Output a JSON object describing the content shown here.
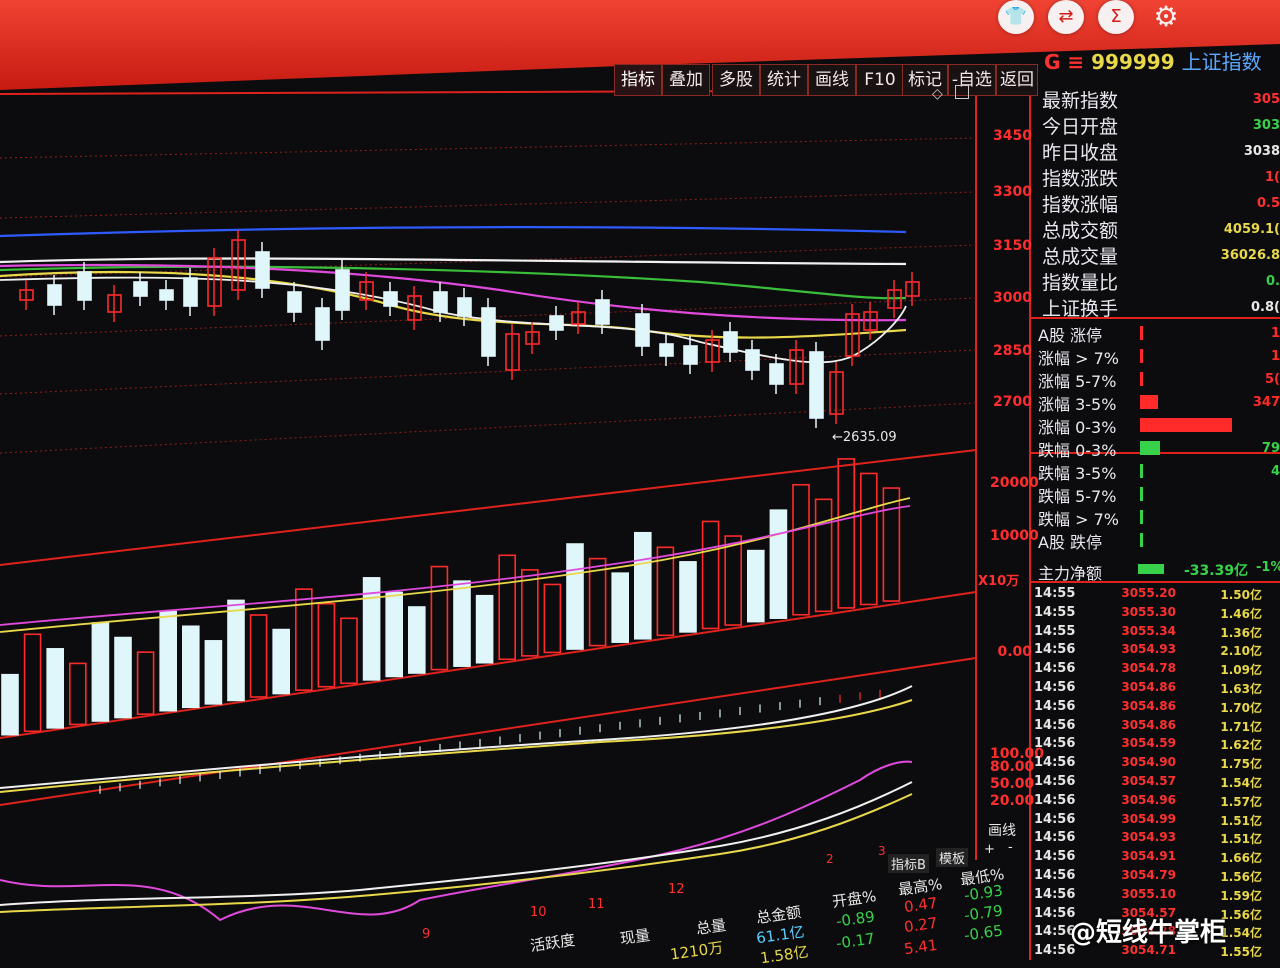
{
  "header": {
    "icons": [
      "shirt-icon",
      "transfer-icon",
      "sigma-icon",
      "gear-icon"
    ]
  },
  "toolbar": {
    "buttons": [
      "指标",
      "叠加",
      "多股",
      "统计",
      "画线",
      "F10",
      "标记",
      "-自选",
      "返回"
    ]
  },
  "stock": {
    "prefix": "G ≡",
    "code": "999999",
    "name": "上证指数"
  },
  "chart": {
    "price_labels": [
      "3450",
      "3300",
      "3150",
      "3000",
      "2850",
      "2700"
    ],
    "low_annotation": "←2635.09",
    "volume_labels": [
      "20000",
      "10000",
      "X10万"
    ],
    "indicator_zero": "0.00",
    "kdj_labels": [
      "100.00",
      "80.00",
      "50.00",
      "20.00"
    ],
    "huaxian": "画线",
    "tabs": [
      "指标B",
      "模板",
      "+",
      "-"
    ],
    "month_labels": [
      "2",
      "3",
      "12",
      "10",
      "11",
      "9"
    ]
  },
  "quote_panel": {
    "rows": [
      {
        "label": "最新指数",
        "value": "305",
        "color": "#ff3030"
      },
      {
        "label": "今日开盘",
        "value": "303",
        "color": "#38d24a"
      },
      {
        "label": "昨日收盘",
        "value": "3038",
        "color": "#e8e8e8"
      },
      {
        "label": "指数涨跌",
        "value": "1(",
        "color": "#ff3030"
      },
      {
        "label": "指数涨幅",
        "value": "0.5",
        "color": "#ff3030"
      },
      {
        "label": "总成交额",
        "value": "4059.1(",
        "color": "#e8d84a"
      },
      {
        "label": "总成交量",
        "value": "36026.8",
        "color": "#e8d84a"
      },
      {
        "label": "指数量比",
        "value": "0.",
        "color": "#38d24a"
      },
      {
        "label": "上证换手",
        "value": "0.8(",
        "color": "#e8e8e8"
      }
    ]
  },
  "breadth": {
    "rows": [
      {
        "label": "A股 涨停",
        "value": "1",
        "bar": 0.02,
        "color": "#ff2a2a"
      },
      {
        "label": "涨幅 > 7%",
        "value": "1",
        "bar": 0.02,
        "color": "#ff2a2a"
      },
      {
        "label": "涨幅 5-7%",
        "value": "5(",
        "bar": 0.03,
        "color": "#ff2a2a"
      },
      {
        "label": "涨幅 3-5%",
        "value": "347",
        "bar": 0.2,
        "color": "#ff2a2a"
      },
      {
        "label": "涨幅 0-3%",
        "value": "",
        "bar": 1.0,
        "color": "#ff2a2a"
      },
      {
        "label": "跌幅 0-3%",
        "value": "79",
        "bar": 0.22,
        "color": "#38d24a"
      },
      {
        "label": "跌幅 3-5%",
        "value": "4",
        "bar": 0.02,
        "color": "#38d24a"
      },
      {
        "label": "跌幅 5-7%",
        "value": "",
        "bar": 0.01,
        "color": "#38d24a"
      },
      {
        "label": "跌幅 > 7%",
        "value": "",
        "bar": 0.01,
        "color": "#38d24a"
      },
      {
        "label": "A股 跌停",
        "value": "",
        "bar": 0.005,
        "color": "#38d24a"
      }
    ],
    "main_inflow_label": "主力净额",
    "main_inflow_value": "-33.39亿",
    "main_inflow_pct": "-1%"
  },
  "ticks": [
    {
      "time": "14:55",
      "price": "3055.20",
      "vol": "1.50亿"
    },
    {
      "time": "14:55",
      "price": "3055.30",
      "vol": "1.46亿"
    },
    {
      "time": "14:55",
      "price": "3055.34",
      "vol": "1.36亿"
    },
    {
      "time": "14:56",
      "price": "3054.93",
      "vol": "2.10亿"
    },
    {
      "time": "14:56",
      "price": "3054.78",
      "vol": "1.09亿"
    },
    {
      "time": "14:56",
      "price": "3054.86",
      "vol": "1.63亿"
    },
    {
      "time": "14:56",
      "price": "3054.86",
      "vol": "1.70亿"
    },
    {
      "time": "14:56",
      "price": "3054.86",
      "vol": "1.71亿"
    },
    {
      "time": "14:56",
      "price": "3054.59",
      "vol": "1.62亿"
    },
    {
      "time": "14:56",
      "price": "3054.90",
      "vol": "1.75亿"
    },
    {
      "time": "14:56",
      "price": "3054.57",
      "vol": "1.54亿"
    },
    {
      "time": "14:56",
      "price": "3054.96",
      "vol": "1.57亿"
    },
    {
      "time": "14:56",
      "price": "3054.99",
      "vol": "1.51亿"
    },
    {
      "time": "14:56",
      "price": "3054.93",
      "vol": "1.51亿"
    },
    {
      "time": "14:56",
      "price": "3054.91",
      "vol": "1.66亿"
    },
    {
      "time": "14:56",
      "price": "3054.79",
      "vol": "1.56亿"
    },
    {
      "time": "14:56",
      "price": "3055.10",
      "vol": "1.59亿"
    },
    {
      "time": "14:56",
      "price": "3054.57",
      "vol": "1.56亿"
    },
    {
      "time": "14:56",
      "price": "3054.28",
      "vol": "1.54亿"
    },
    {
      "time": "14:56",
      "price": "3054.71",
      "vol": "1.55亿"
    }
  ],
  "bottom_table": {
    "headers": [
      "活跃度",
      "现量",
      "总量",
      "总金额",
      "开盘%",
      "最高%",
      "最低%"
    ],
    "row1": [
      "",
      "",
      "1210万",
      "61.1亿",
      "-0.89",
      "0.47",
      "-0.93"
    ],
    "row2": [
      "",
      "",
      "",
      "1.58亿",
      "-0.17",
      "0.27",
      "-0.79"
    ],
    "row3": [
      "",
      "",
      "",
      "",
      "",
      "5.41",
      "-0.65"
    ]
  },
  "watermark": "@短线牛掌柜"
}
